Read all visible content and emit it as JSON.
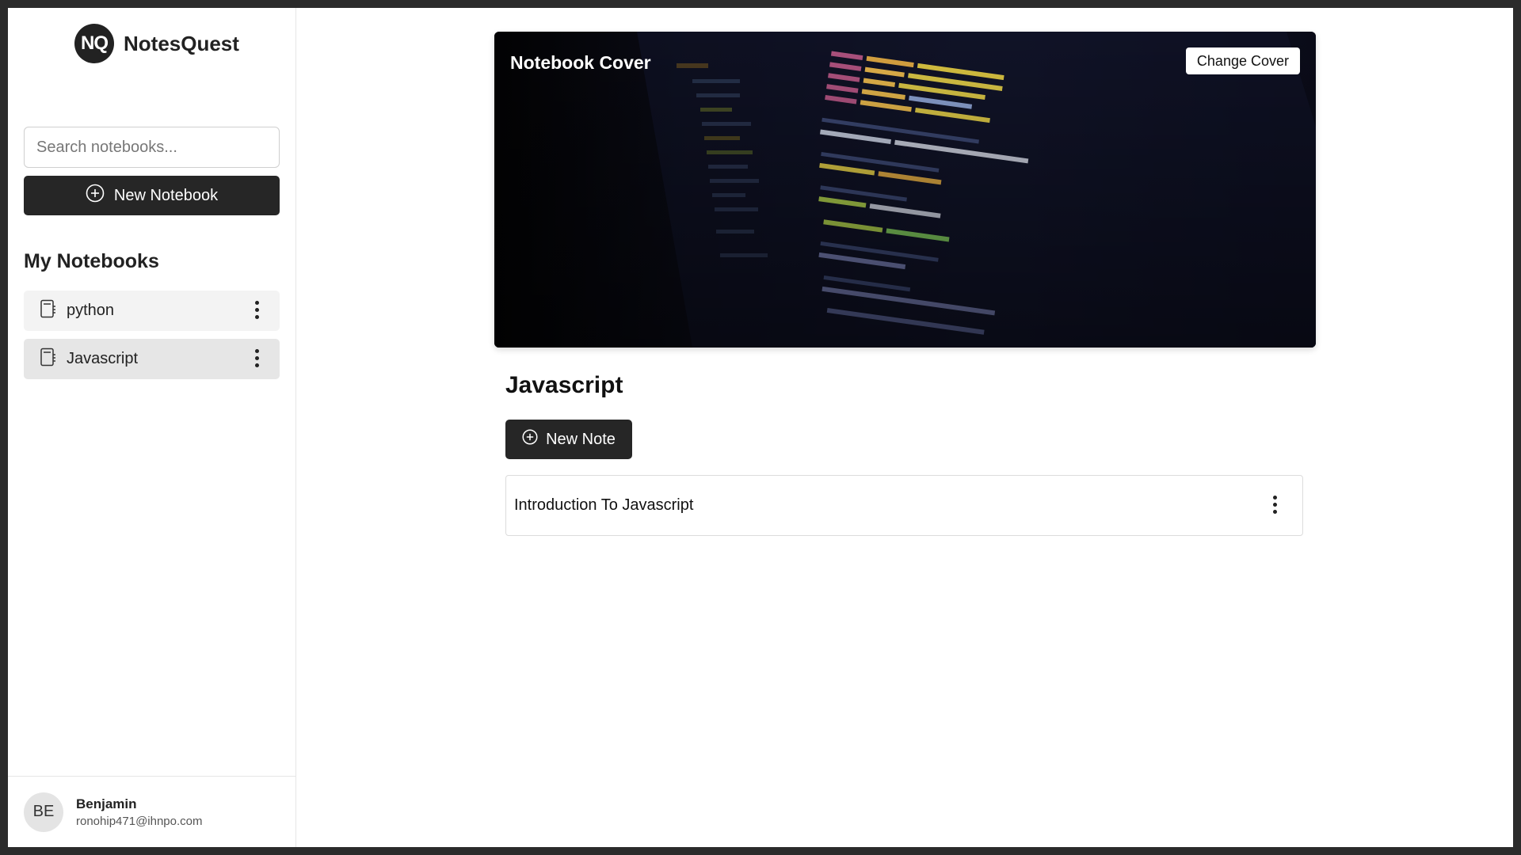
{
  "brand": {
    "logo_text": "NQ",
    "name": "NotesQuest"
  },
  "search": {
    "placeholder": "Search notebooks..."
  },
  "sidebar": {
    "new_notebook_label": "New Notebook",
    "section_title": "My Notebooks",
    "notebooks": [
      {
        "label": "python",
        "active": false
      },
      {
        "label": "Javascript",
        "active": true
      }
    ]
  },
  "user": {
    "initials": "BE",
    "name": "Benjamin",
    "email": "ronohip471@ihnpo.com"
  },
  "cover": {
    "title": "Notebook Cover",
    "change_label": "Change Cover"
  },
  "notebook": {
    "title": "Javascript",
    "new_note_label": "New Note",
    "notes": [
      {
        "title": "Introduction To Javascript"
      }
    ]
  },
  "colors": {
    "primary_button": "#262626",
    "active_item": "#e6e6e6",
    "item": "#f3f3f3"
  },
  "icons": {
    "new_notebook": "plus-circle-icon",
    "notebook": "notebook-icon",
    "menu": "kebab-menu-icon",
    "new_note": "plus-circle-icon"
  }
}
